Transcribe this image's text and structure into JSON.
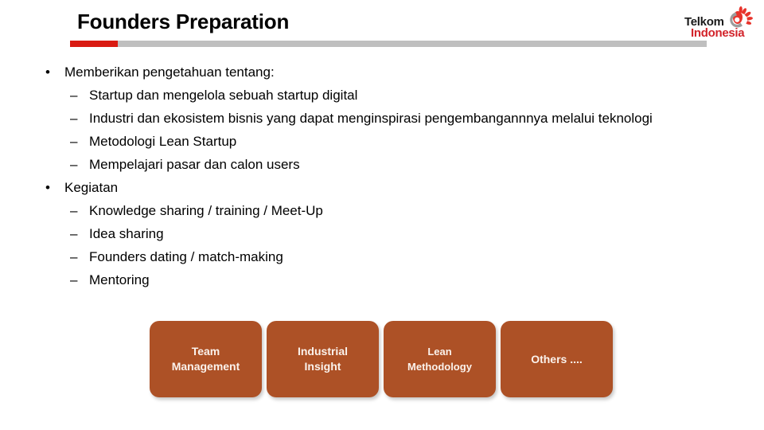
{
  "slide": {
    "title": "Founders Preparation",
    "accent_red": "#d91b12",
    "accent_gray": "#bfbfbf",
    "box_color": "#ad5126"
  },
  "logo": {
    "line1": "Telkom",
    "line2": "Indonesia",
    "mark": "telkom-hand-icon"
  },
  "content": {
    "groups": [
      {
        "bullet": "•",
        "heading": "Memberikan pengetahuan tentang:",
        "items": [
          {
            "marker": "–",
            "text": "Startup dan mengelola sebuah startup digital"
          },
          {
            "marker": "–",
            "text": "Industri dan ekosistem bisnis yang dapat menginspirasi pengembangannnya melalui teknologi"
          },
          {
            "marker": "–",
            "text": "Metodologi Lean Startup"
          },
          {
            "marker": "–",
            "text": "Mempelajari pasar dan calon users"
          }
        ]
      },
      {
        "bullet": "•",
        "heading": "Kegiatan",
        "items": [
          {
            "marker": "–",
            "text": "Knowledge sharing / training / Meet-Up"
          },
          {
            "marker": "–",
            "text": "Idea sharing"
          },
          {
            "marker": "–",
            "text": "Founders dating / match-making"
          },
          {
            "marker": "–",
            "text": "Mentoring"
          }
        ]
      }
    ]
  },
  "boxes": [
    {
      "label": "Team\nManagement"
    },
    {
      "label": "Industrial\nInsight"
    },
    {
      "label": "Lean\nMethodology"
    },
    {
      "label": "Others ...."
    }
  ]
}
